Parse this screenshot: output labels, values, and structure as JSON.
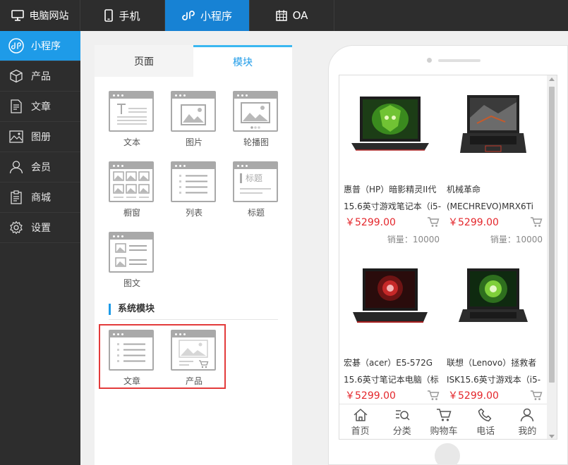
{
  "topbar": {
    "tabs": [
      {
        "label": "电脑网站",
        "icon": "monitor-icon"
      },
      {
        "label": "手机",
        "icon": "phone-icon"
      },
      {
        "label": "小程序",
        "icon": "miniprogram-icon",
        "active": true
      },
      {
        "label": "OA",
        "icon": "calendar-icon"
      }
    ]
  },
  "sidebar": {
    "items": [
      {
        "label": "小程序",
        "icon": "miniprogram-icon",
        "active": true
      },
      {
        "label": "产品",
        "icon": "box-icon"
      },
      {
        "label": "文章",
        "icon": "document-icon"
      },
      {
        "label": "图册",
        "icon": "image-icon"
      },
      {
        "label": "会员",
        "icon": "user-icon"
      },
      {
        "label": "商城",
        "icon": "clipboard-icon"
      },
      {
        "label": "设置",
        "icon": "gear-icon"
      }
    ]
  },
  "panel": {
    "tabs": [
      "页面",
      "模块"
    ],
    "active_tab": "模块",
    "modules": [
      {
        "label": "文本",
        "icon": "text-module-icon"
      },
      {
        "label": "图片",
        "icon": "picture-module-icon"
      },
      {
        "label": "轮播图",
        "icon": "carousel-module-icon"
      },
      {
        "label": "橱窗",
        "icon": "showcase-module-icon"
      },
      {
        "label": "列表",
        "icon": "list-module-icon"
      },
      {
        "label": "标题",
        "icon": "title-module-icon"
      },
      {
        "label": "图文",
        "icon": "image-text-module-icon"
      }
    ],
    "title_module_text": "标题",
    "system_section_title": "系统模块",
    "system_modules": [
      {
        "label": "文章",
        "icon": "article-module-icon"
      },
      {
        "label": "产品",
        "icon": "product-module-icon"
      }
    ]
  },
  "phone": {
    "products": [
      {
        "title_line1": "惠普（HP）暗影精灵II代",
        "title_line2": "15.6英寸游戏笔记本（i5-",
        "price": "￥5299.00",
        "sales": "销量：10000"
      },
      {
        "title_line1": "机械革命",
        "title_line2": "(MECHREVO)MRX6Ti",
        "price": "￥5299.00",
        "sales": "销量：10000"
      },
      {
        "title_line1": "宏碁（acer）E5-572G",
        "title_line2": "15.6英寸笔记本电脑（标",
        "price": "￥5299.00",
        "sales": ""
      },
      {
        "title_line1": "联想（Lenovo）拯救者",
        "title_line2": "ISK15.6英寸游戏本（i5-",
        "price": "￥5299.00",
        "sales": ""
      }
    ],
    "tabbar": [
      {
        "label": "首页",
        "icon": "home-icon"
      },
      {
        "label": "分类",
        "icon": "category-search-icon"
      },
      {
        "label": "购物车",
        "icon": "cart-icon"
      },
      {
        "label": "电话",
        "icon": "telephone-icon"
      },
      {
        "label": "我的",
        "icon": "user-icon"
      }
    ]
  },
  "colors": {
    "topbar_bg": "#2d2d2d",
    "active_blue": "#1782d4",
    "sidebar_active": "#1e9be8",
    "price_red": "#e4262b",
    "highlight_red": "#e33b3b"
  }
}
